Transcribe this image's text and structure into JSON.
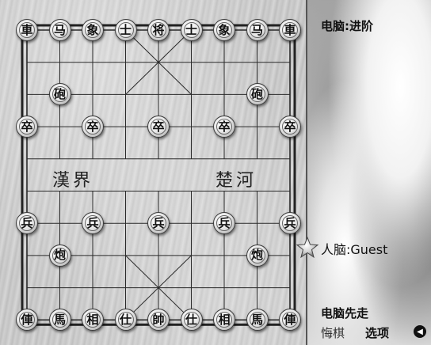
{
  "panel": {
    "computer_label": "电脑:进阶",
    "human_label": "人脑:Guest",
    "status": "电脑先走",
    "undo_button": "悔棋",
    "options_button": "选项"
  },
  "icons": {
    "sound": "sound-icon",
    "turn_marker": "star-icon"
  },
  "board": {
    "river_left": "漢界",
    "river_right": "楚河",
    "pieces": [
      {
        "char": "車",
        "col": 0,
        "row": 0
      },
      {
        "char": "马",
        "col": 1,
        "row": 0
      },
      {
        "char": "象",
        "col": 2,
        "row": 0
      },
      {
        "char": "士",
        "col": 3,
        "row": 0
      },
      {
        "char": "将",
        "col": 4,
        "row": 0
      },
      {
        "char": "士",
        "col": 5,
        "row": 0
      },
      {
        "char": "象",
        "col": 6,
        "row": 0
      },
      {
        "char": "马",
        "col": 7,
        "row": 0
      },
      {
        "char": "車",
        "col": 8,
        "row": 0
      },
      {
        "char": "砲",
        "col": 1,
        "row": 2
      },
      {
        "char": "砲",
        "col": 7,
        "row": 2
      },
      {
        "char": "卒",
        "col": 0,
        "row": 3
      },
      {
        "char": "卒",
        "col": 2,
        "row": 3
      },
      {
        "char": "卒",
        "col": 4,
        "row": 3
      },
      {
        "char": "卒",
        "col": 6,
        "row": 3
      },
      {
        "char": "卒",
        "col": 8,
        "row": 3
      },
      {
        "char": "兵",
        "col": 0,
        "row": 6
      },
      {
        "char": "兵",
        "col": 2,
        "row": 6
      },
      {
        "char": "兵",
        "col": 4,
        "row": 6
      },
      {
        "char": "兵",
        "col": 6,
        "row": 6
      },
      {
        "char": "兵",
        "col": 8,
        "row": 6
      },
      {
        "char": "炮",
        "col": 1,
        "row": 7
      },
      {
        "char": "炮",
        "col": 7,
        "row": 7
      },
      {
        "char": "俥",
        "col": 0,
        "row": 9
      },
      {
        "char": "馬",
        "col": 1,
        "row": 9
      },
      {
        "char": "相",
        "col": 2,
        "row": 9
      },
      {
        "char": "仕",
        "col": 3,
        "row": 9
      },
      {
        "char": "帥",
        "col": 4,
        "row": 9
      },
      {
        "char": "仕",
        "col": 5,
        "row": 9
      },
      {
        "char": "相",
        "col": 6,
        "row": 9
      },
      {
        "char": "馬",
        "col": 7,
        "row": 9
      },
      {
        "char": "俥",
        "col": 8,
        "row": 9
      }
    ]
  }
}
